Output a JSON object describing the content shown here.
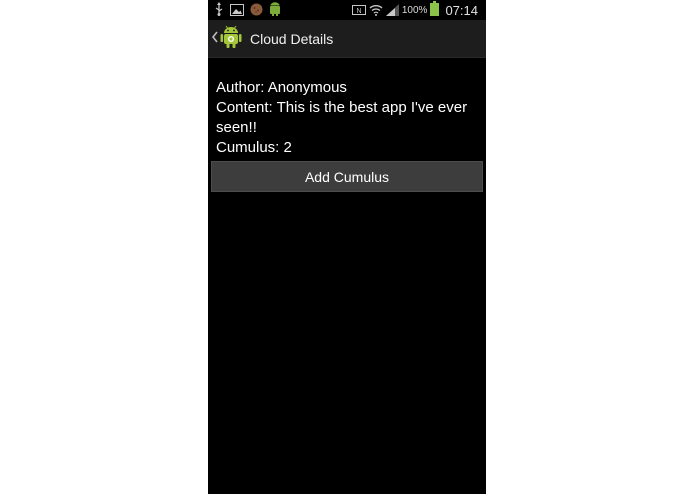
{
  "status_bar": {
    "battery_percent": "100%",
    "time": "07:14",
    "left_icons": [
      "usb-icon",
      "gallery-icon",
      "cookie-icon",
      "android-notification-icon"
    ],
    "right_icons": [
      "nfc-icon",
      "wifi-icon",
      "signal-icon",
      "battery-icon"
    ]
  },
  "action_bar": {
    "title": "Cloud Details",
    "icon": "android-app-icon"
  },
  "details": {
    "author": "Author: Anonymous",
    "content": "Content: This is the best app I've ever seen!!",
    "cumulus": "Cumulus: 2"
  },
  "add_button_label": "Add Cumulus",
  "colors": {
    "background": "#000000",
    "action_bar": "#1d1d1d",
    "button": "#3d3d3d",
    "battery": "#8bc34a",
    "android_green": "#a4c639"
  }
}
